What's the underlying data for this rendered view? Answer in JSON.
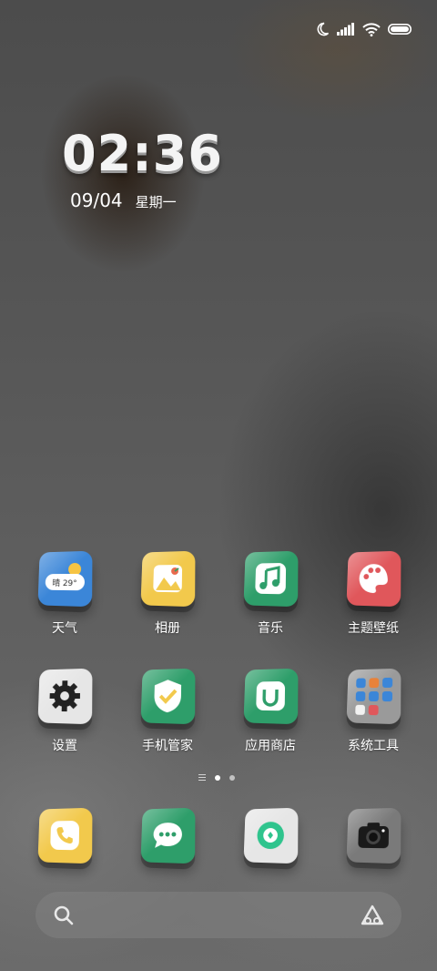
{
  "status_bar": {
    "icons": [
      "moon-icon",
      "signal-icon",
      "wifi-icon",
      "battery-icon"
    ]
  },
  "clock": {
    "time": "02:36",
    "date": "09/04",
    "weekday": "星期一"
  },
  "weather_widget": {
    "text": "晴 29°"
  },
  "apps_row1": [
    {
      "label": "天气",
      "icon": "weather-icon",
      "color": "#3b86d8"
    },
    {
      "label": "相册",
      "icon": "gallery-icon",
      "color": "#f2c94c"
    },
    {
      "label": "音乐",
      "icon": "music-icon",
      "color": "#2e9e6a"
    },
    {
      "label": "主题壁纸",
      "icon": "theme-palette-icon",
      "color": "#e0575b"
    }
  ],
  "apps_row2": [
    {
      "label": "设置",
      "icon": "settings-gear-icon",
      "color": "#e6e6e6"
    },
    {
      "label": "手机管家",
      "icon": "security-shield-icon",
      "color": "#2e9e6a"
    },
    {
      "label": "应用商店",
      "icon": "app-store-icon",
      "color": "#2e9e6a"
    },
    {
      "label": "系统工具",
      "icon": "folder-icon",
      "color": "#9a9a9a"
    }
  ],
  "dock": [
    {
      "icon": "phone-icon",
      "color": "#f2c94c"
    },
    {
      "icon": "messages-icon",
      "color": "#2e9e6a"
    },
    {
      "icon": "browser-icon",
      "color": "#e6e6e6"
    },
    {
      "icon": "camera-icon",
      "color": "#7a7a7a"
    }
  ],
  "page_indicator": {
    "pages": 2,
    "current": 1
  },
  "search": {
    "left_icon": "search-icon",
    "right_icon": "ai-assistant-icon"
  }
}
